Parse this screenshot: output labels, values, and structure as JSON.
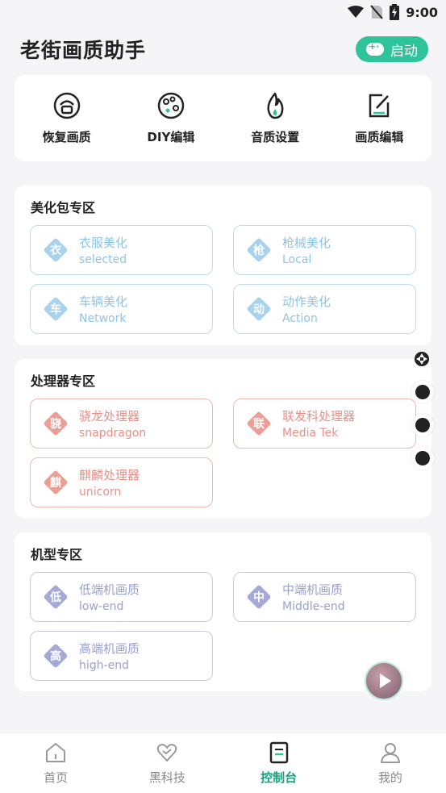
{
  "status_bar": {
    "time": "9:00"
  },
  "header": {
    "title": "老街画质助手",
    "launch_label": "启动"
  },
  "quick_actions": [
    {
      "label": "恢复画质",
      "icon": "restore-icon"
    },
    {
      "label": "DIY编辑",
      "icon": "palette-icon"
    },
    {
      "label": "音质设置",
      "icon": "flame-icon"
    },
    {
      "label": "画质编辑",
      "icon": "edit-icon"
    }
  ],
  "beauty_section": {
    "title": "美化包专区",
    "items": [
      {
        "badge": "衣",
        "title": "衣服美化",
        "subtitle": "selected"
      },
      {
        "badge": "枪",
        "title": "枪械美化",
        "subtitle": "Local"
      },
      {
        "badge": "车",
        "title": "车辆美化",
        "subtitle": "Network"
      },
      {
        "badge": "动",
        "title": "动作美化",
        "subtitle": "Action"
      }
    ]
  },
  "processor_section": {
    "title": "处理器专区",
    "items": [
      {
        "badge": "骁",
        "title": "骁龙处理器",
        "subtitle": "snapdragon"
      },
      {
        "badge": "联",
        "title": "联发科处理器",
        "subtitle": "Media Tek"
      },
      {
        "badge": "麒",
        "title": "麒麟处理器",
        "subtitle": "unicorn"
      }
    ]
  },
  "model_section": {
    "title": "机型专区",
    "items": [
      {
        "badge": "低",
        "title": "低端机画质",
        "subtitle": "low-end"
      },
      {
        "badge": "中",
        "title": "中端机画质",
        "subtitle": "Middle-end"
      },
      {
        "badge": "高",
        "title": "高端机画质",
        "subtitle": "high-end"
      }
    ]
  },
  "bottom_nav": [
    {
      "label": "首页",
      "icon": "home-icon"
    },
    {
      "label": "黑科技",
      "icon": "heart-icon"
    },
    {
      "label": "控制台",
      "icon": "console-icon",
      "active": true
    },
    {
      "label": "我的",
      "icon": "profile-icon"
    }
  ],
  "colors": {
    "accent": "#2ec39a",
    "active_nav": "#18a37e",
    "blue": "#8ec4e6",
    "red": "#e88f86",
    "purple": "#9aa0cc"
  }
}
